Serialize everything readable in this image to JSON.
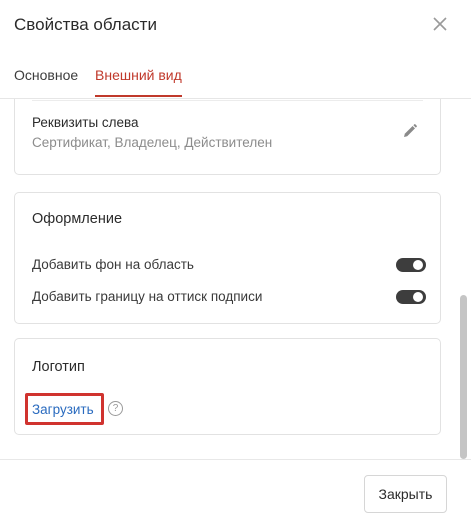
{
  "dialog": {
    "title": "Свойства области",
    "close_icon": "close-icon"
  },
  "tabs": [
    {
      "label": "Основное",
      "active": false
    },
    {
      "label": "Внешний вид",
      "active": true
    }
  ],
  "accent_color": "#c0392b",
  "requisites": {
    "label": "Реквизиты слева",
    "value": "Сертификат, Владелец, Действителен",
    "edit_icon": "pencil-icon"
  },
  "design": {
    "title": "Оформление",
    "options": [
      {
        "label": "Добавить фон на область",
        "enabled": true
      },
      {
        "label": "Добавить границу на оттиск подписи",
        "enabled": true
      }
    ]
  },
  "logo": {
    "title": "Логотип",
    "upload_label": "Загрузить",
    "help_icon": "?"
  },
  "footer": {
    "close_label": "Закрыть"
  }
}
